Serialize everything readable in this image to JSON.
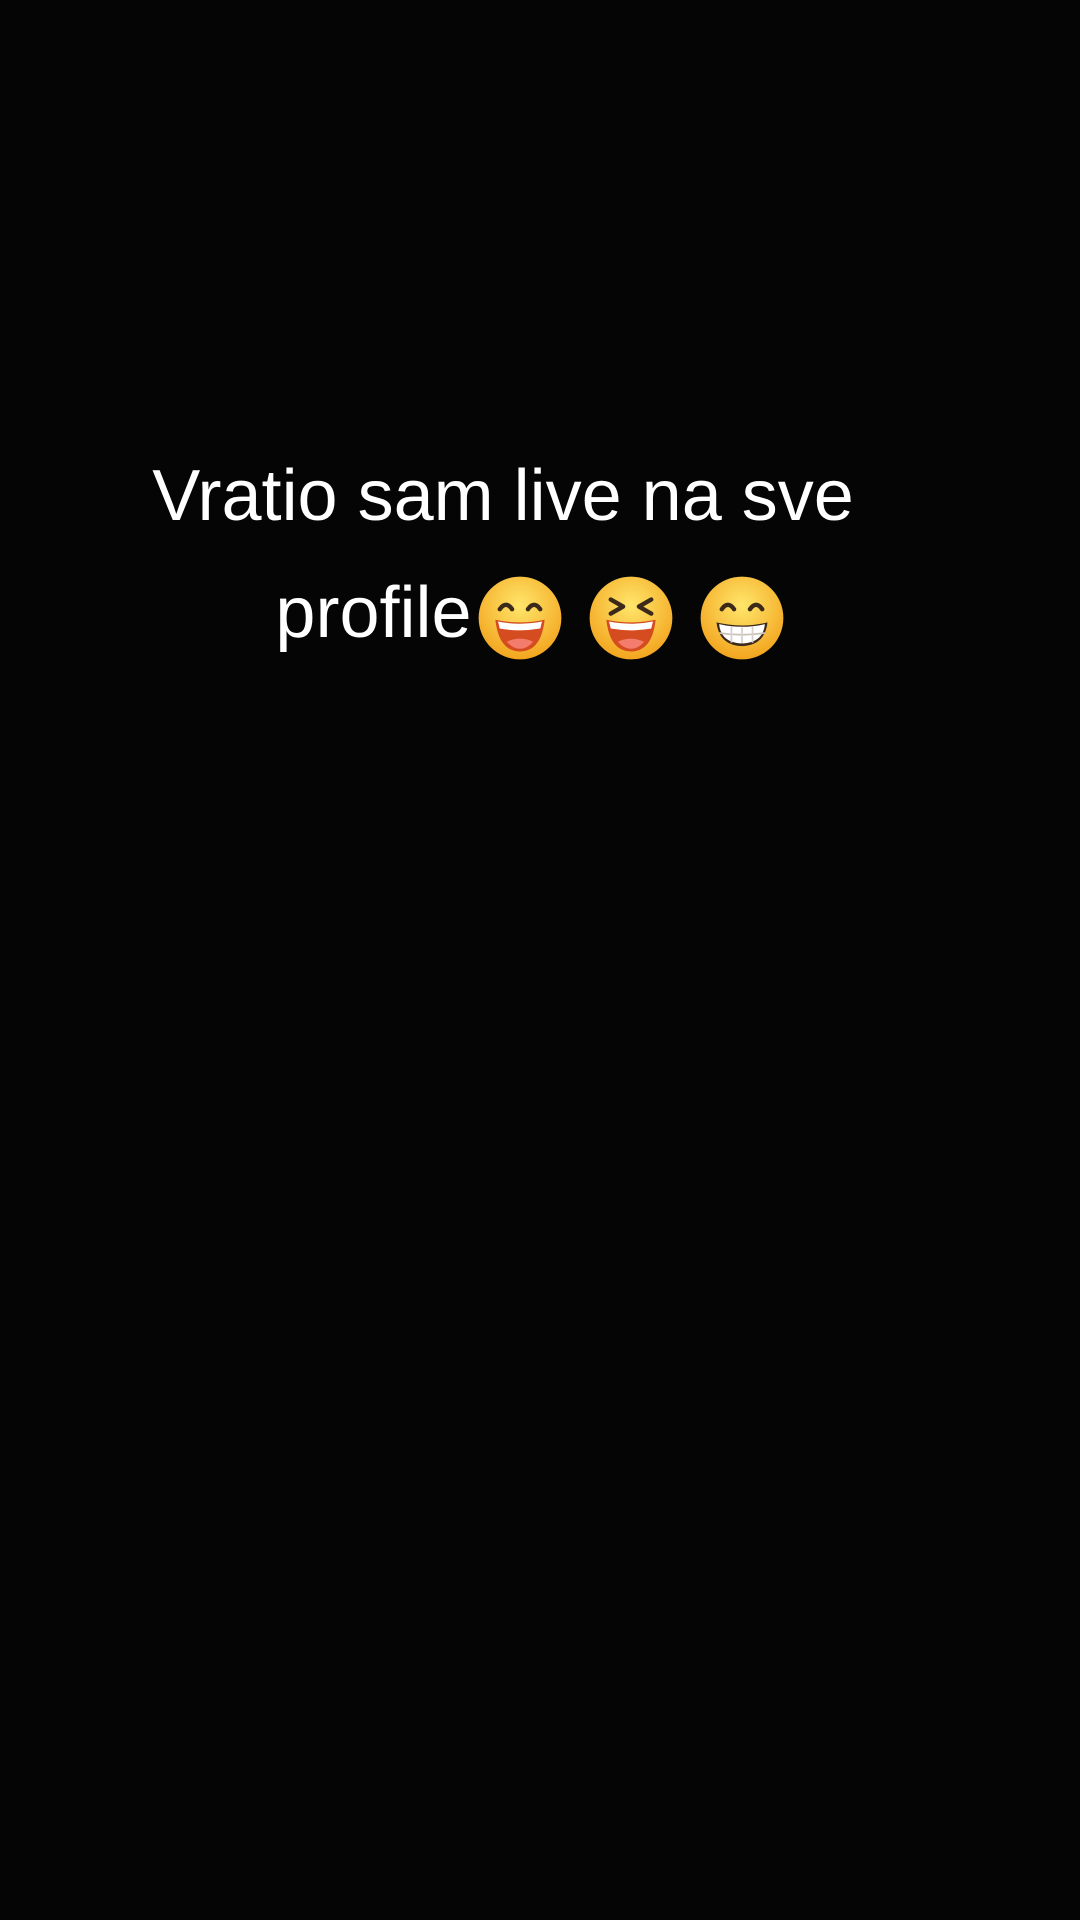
{
  "caption": {
    "line1": "Vratio sam live na sve",
    "line2": "profile"
  },
  "emojis": [
    {
      "name": "grinning-face-with-smiling-eyes-icon",
      "glyph": "😄"
    },
    {
      "name": "grinning-squinting-face-icon",
      "glyph": "😆"
    },
    {
      "name": "beaming-face-with-smiling-eyes-icon",
      "glyph": "😁"
    }
  ],
  "colors": {
    "background": "#050505",
    "text": "#ffffff",
    "emoji_face": "#f8c133",
    "emoji_mouth": "#d8521f"
  }
}
